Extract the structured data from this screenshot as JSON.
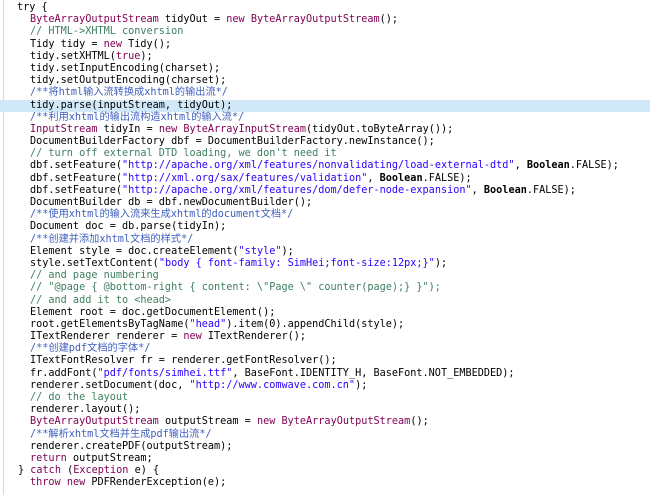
{
  "editor": {
    "lines": [
      {
        "indent": 1,
        "tokens": [
          {
            "t": "try",
            "c": "dflt"
          },
          {
            "t": " {",
            "c": "dflt"
          }
        ]
      },
      {
        "indent": 3,
        "tokens": [
          {
            "t": "ByteArrayOutputStream",
            "c": "cls"
          },
          {
            "t": " tidyOut = ",
            "c": "dflt"
          },
          {
            "t": "new",
            "c": "kw"
          },
          {
            "t": " ",
            "c": "dflt"
          },
          {
            "t": "ByteArrayOutputStream",
            "c": "cls"
          },
          {
            "t": "();",
            "c": "dflt"
          }
        ]
      },
      {
        "indent": 3,
        "tokens": [
          {
            "t": "// HTML->XHTML conversion",
            "c": "cmt"
          }
        ]
      },
      {
        "indent": 3,
        "tokens": [
          {
            "t": "Tidy tidy = ",
            "c": "dflt"
          },
          {
            "t": "new",
            "c": "kw"
          },
          {
            "t": " Tidy();",
            "c": "dflt"
          }
        ]
      },
      {
        "indent": 3,
        "tokens": [
          {
            "t": "tidy.setXHTML(",
            "c": "dflt"
          },
          {
            "t": "true",
            "c": "kw"
          },
          {
            "t": ");",
            "c": "dflt"
          }
        ]
      },
      {
        "indent": 3,
        "tokens": [
          {
            "t": "tidy.setInputEncoding(charset);",
            "c": "dflt"
          }
        ]
      },
      {
        "indent": 3,
        "tokens": [
          {
            "t": "tidy.setOutputEncoding(charset);",
            "c": "dflt"
          }
        ]
      },
      {
        "indent": 3,
        "tokens": [
          {
            "t": "/**将html输入流转换成xhtml的输出流*/",
            "c": "doc"
          }
        ]
      },
      {
        "indent": 3,
        "hl": true,
        "tokens": [
          {
            "t": "tidy.parse(inputStream, tidyOut);",
            "c": "dflt"
          }
        ]
      },
      {
        "indent": 3,
        "tokens": [
          {
            "t": "/**利用xhtml的输出流构造xhtml的输入流*/",
            "c": "doc"
          }
        ]
      },
      {
        "indent": 3,
        "tokens": [
          {
            "t": "InputStream",
            "c": "cls"
          },
          {
            "t": " tidyIn = ",
            "c": "dflt"
          },
          {
            "t": "new",
            "c": "kw"
          },
          {
            "t": " ",
            "c": "dflt"
          },
          {
            "t": "ByteArrayInputStream",
            "c": "cls"
          },
          {
            "t": "(tidyOut.toByteArray());",
            "c": "dflt"
          }
        ]
      },
      {
        "indent": 3,
        "tokens": [
          {
            "t": "DocumentBuilderFactory dbf = DocumentBuilderFactory.newInstance();",
            "c": "dflt"
          }
        ]
      },
      {
        "indent": 3,
        "tokens": [
          {
            "t": "// turn off external DTD loading, we don't need it",
            "c": "cmt"
          }
        ]
      },
      {
        "indent": 3,
        "tokens": [
          {
            "t": "dbf.setFeature(",
            "c": "dflt"
          },
          {
            "t": "\"http://apache.org/xml/features/nonvalidating/load-external-dtd\"",
            "c": "str"
          },
          {
            "t": ", ",
            "c": "dflt"
          },
          {
            "t": "Boolean",
            "c": "bold"
          },
          {
            "t": ".FALSE);",
            "c": "dflt"
          }
        ]
      },
      {
        "indent": 3,
        "tokens": [
          {
            "t": "dbf.setFeature(",
            "c": "dflt"
          },
          {
            "t": "\"http://xml.org/sax/features/validation\"",
            "c": "str"
          },
          {
            "t": ", ",
            "c": "dflt"
          },
          {
            "t": "Boolean",
            "c": "bold"
          },
          {
            "t": ".FALSE);",
            "c": "dflt"
          }
        ]
      },
      {
        "indent": 3,
        "tokens": [
          {
            "t": "dbf.setFeature(",
            "c": "dflt"
          },
          {
            "t": "\"http://apache.org/xml/features/dom/defer-node-expansion\"",
            "c": "str"
          },
          {
            "t": ", ",
            "c": "dflt"
          },
          {
            "t": "Boolean",
            "c": "bold"
          },
          {
            "t": ".FALSE);",
            "c": "dflt"
          }
        ]
      },
      {
        "indent": 3,
        "tokens": [
          {
            "t": "DocumentBuilder db = dbf.newDocumentBuilder();",
            "c": "dflt"
          }
        ]
      },
      {
        "indent": 3,
        "tokens": [
          {
            "t": "/**使用xhtml的输入流来生成xhtml的document文档*/",
            "c": "doc"
          }
        ]
      },
      {
        "indent": 3,
        "tokens": [
          {
            "t": "Document doc = db.parse(tidyIn);",
            "c": "dflt"
          }
        ]
      },
      {
        "indent": 3,
        "tokens": [
          {
            "t": "/**创建并添加xhtml文档的样式*/",
            "c": "doc"
          }
        ]
      },
      {
        "indent": 3,
        "tokens": [
          {
            "t": "Element style = doc.createElement(",
            "c": "dflt"
          },
          {
            "t": "\"style\"",
            "c": "str"
          },
          {
            "t": ");",
            "c": "dflt"
          }
        ]
      },
      {
        "indent": 3,
        "tokens": [
          {
            "t": "style.setTextContent(",
            "c": "dflt"
          },
          {
            "t": "\"body { font-family: SimHei;font-size:12px;}\"",
            "c": "str"
          },
          {
            "t": ");",
            "c": "dflt"
          }
        ]
      },
      {
        "indent": 3,
        "tokens": [
          {
            "t": "// and page numbering",
            "c": "cmt"
          }
        ]
      },
      {
        "indent": 3,
        "tokens": [
          {
            "t": "// \"@page { @bottom-right { content: \\\"Page \\\" counter(page);} }\");",
            "c": "cmt"
          }
        ]
      },
      {
        "indent": 3,
        "tokens": [
          {
            "t": "// and add it to <head>",
            "c": "cmt"
          }
        ]
      },
      {
        "indent": 3,
        "tokens": [
          {
            "t": "Element root = doc.getDocumentElement();",
            "c": "dflt"
          }
        ]
      },
      {
        "indent": 3,
        "tokens": [
          {
            "t": "root.getElementsByTagName(",
            "c": "dflt"
          },
          {
            "t": "\"head\"",
            "c": "str"
          },
          {
            "t": ").item(0).appendChild(style);",
            "c": "dflt"
          }
        ]
      },
      {
        "indent": 3,
        "tokens": [
          {
            "t": "ITextRenderer renderer = ",
            "c": "dflt"
          },
          {
            "t": "new",
            "c": "kw"
          },
          {
            "t": " ITextRenderer();",
            "c": "dflt"
          }
        ]
      },
      {
        "indent": 3,
        "tokens": [
          {
            "t": "/**创建pdf文档的字体*/",
            "c": "doc"
          }
        ]
      },
      {
        "indent": 3,
        "tokens": [
          {
            "t": "ITextFontResolver fr = renderer.getFontResolver();",
            "c": "dflt"
          }
        ]
      },
      {
        "indent": 3,
        "tokens": [
          {
            "t": "fr.addFont(",
            "c": "dflt"
          },
          {
            "t": "\"pdf/fonts/simhei.ttf\"",
            "c": "str"
          },
          {
            "t": ", BaseFont.IDENTITY_H, BaseFont.NOT_EMBEDDED);",
            "c": "dflt"
          }
        ]
      },
      {
        "indent": 3,
        "tokens": [
          {
            "t": "renderer.setDocument(doc, ",
            "c": "dflt"
          },
          {
            "t": "\"http://www.comwave.com.cn\"",
            "c": "str"
          },
          {
            "t": ");",
            "c": "dflt"
          }
        ]
      },
      {
        "indent": 3,
        "tokens": [
          {
            "t": "// do the layout",
            "c": "cmt"
          }
        ]
      },
      {
        "indent": 3,
        "tokens": [
          {
            "t": "renderer.layout();",
            "c": "dflt"
          }
        ]
      },
      {
        "indent": 3,
        "tokens": [
          {
            "t": "ByteArrayOutputStream",
            "c": "cls"
          },
          {
            "t": " outputStream = ",
            "c": "dflt"
          },
          {
            "t": "new",
            "c": "kw"
          },
          {
            "t": " ",
            "c": "dflt"
          },
          {
            "t": "ByteArrayOutputStream",
            "c": "cls"
          },
          {
            "t": "();",
            "c": "dflt"
          }
        ]
      },
      {
        "indent": 3,
        "tokens": [
          {
            "t": "/**解析xhtml文档并生成pdf输出流*/",
            "c": "doc"
          }
        ]
      },
      {
        "indent": 3,
        "tokens": [
          {
            "t": "renderer.createPDF(outputStream);",
            "c": "dflt"
          }
        ]
      },
      {
        "indent": 3,
        "tokens": [
          {
            "t": "return",
            "c": "kw"
          },
          {
            "t": " outputStream;",
            "c": "dflt"
          }
        ]
      },
      {
        "indent": 2,
        "tokens": [
          {
            "t": "} ",
            "c": "dflt"
          },
          {
            "t": "catch",
            "c": "kw"
          },
          {
            "t": " (",
            "c": "dflt"
          },
          {
            "t": "Exception",
            "c": "cls"
          },
          {
            "t": " e) {",
            "c": "dflt"
          }
        ]
      },
      {
        "indent": 3,
        "tokens": [
          {
            "t": "throw",
            "c": "kw"
          },
          {
            "t": " ",
            "c": "dflt"
          },
          {
            "t": "new",
            "c": "kw"
          },
          {
            "t": " PDFRenderException(e);",
            "c": "dflt"
          }
        ]
      }
    ]
  },
  "colors": {
    "keyword": "#7f0055",
    "string": "#2a00ff",
    "comment": "#3f7f5f",
    "javadoc": "#3f5fbf",
    "highlight": "#d0e8f8",
    "background": "#ffffff"
  }
}
